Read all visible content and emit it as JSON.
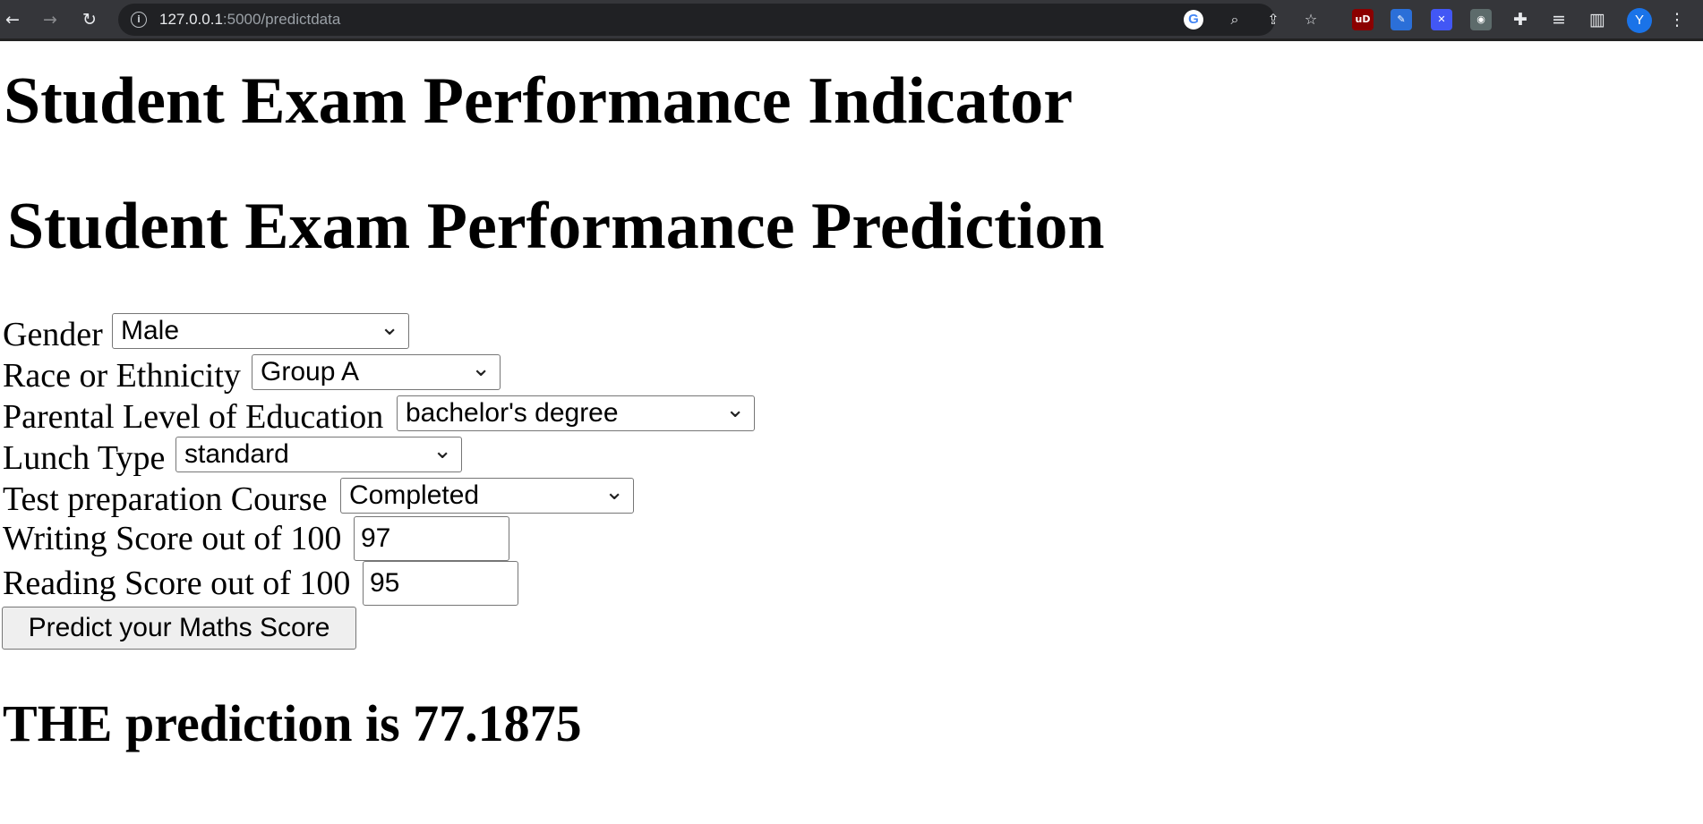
{
  "browser": {
    "url_host": "127.0.0.1",
    "url_path": ":5000/predictdata",
    "avatar_initial": "Y"
  },
  "page": {
    "title": "Student Exam Performance Indicator",
    "subtitle": "Student Exam Performance Prediction",
    "fields": {
      "gender": {
        "label": "Gender",
        "value": "Male"
      },
      "ethnicity": {
        "label": "Race or Ethnicity",
        "value": "Group A"
      },
      "parental_education": {
        "label": "Parental Level of Education",
        "value": "bachelor's degree"
      },
      "lunch": {
        "label": "Lunch Type",
        "value": "standard"
      },
      "test_prep": {
        "label": "Test preparation Course",
        "value": "Completed"
      },
      "writing": {
        "label": "Writing Score out of 100",
        "value": "97"
      },
      "reading": {
        "label": "Reading Score out of 100",
        "value": "95"
      }
    },
    "submit_label": "Predict your Maths Score",
    "result": "THE prediction is 77.1875"
  }
}
